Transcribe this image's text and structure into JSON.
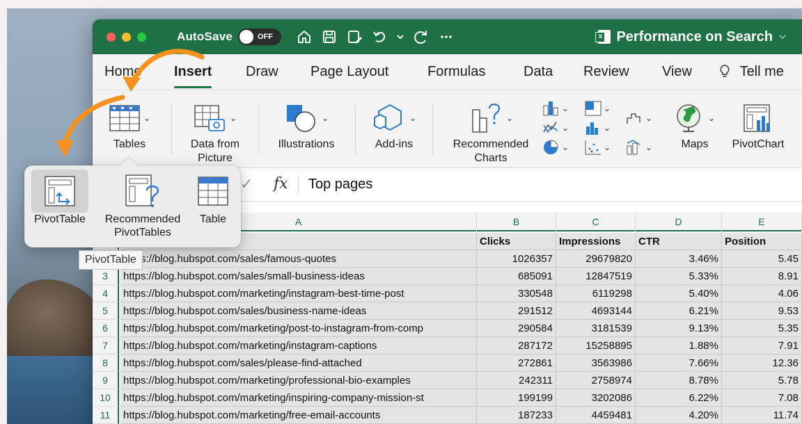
{
  "window": {
    "autosave_label": "AutoSave",
    "autosave_state": "OFF",
    "doc_title": "Performance on Search"
  },
  "tabs": [
    {
      "label": "Home"
    },
    {
      "label": "Insert",
      "active": true
    },
    {
      "label": "Draw"
    },
    {
      "label": "Page Layout"
    },
    {
      "label": "Formulas"
    },
    {
      "label": "Data"
    },
    {
      "label": "Review"
    },
    {
      "label": "View"
    },
    {
      "label": "Tell me"
    }
  ],
  "ribbon": {
    "tables": "Tables",
    "data_from_picture_1": "Data from",
    "data_from_picture_2": "Picture",
    "illustrations": "Illustrations",
    "addins": "Add-ins",
    "recommended_charts_1": "Recommended",
    "recommended_charts_2": "Charts",
    "maps": "Maps",
    "pivotchart": "PivotChart"
  },
  "popover": {
    "pivottable": "PivotTable",
    "recommended_1": "Recommended",
    "recommended_2": "PivotTables",
    "table": "Table",
    "tooltip": "PivotTable"
  },
  "formula": {
    "fx": "fx",
    "value": "Top pages"
  },
  "columns": [
    "A",
    "B",
    "C",
    "D",
    "E"
  ],
  "headers": {
    "clicks": "Clicks",
    "impressions": "Impressions",
    "ctr": "CTR",
    "position": "Position"
  },
  "rows": [
    {
      "num": "2",
      "url": "https://blog.hubspot.com/sales/famous-quotes",
      "clicks": "1026357",
      "impressions": "29679820",
      "ctr": "3.46%",
      "position": "5.45"
    },
    {
      "num": "3",
      "url": "https://blog.hubspot.com/sales/small-business-ideas",
      "clicks": "685091",
      "impressions": "12847519",
      "ctr": "5.33%",
      "position": "8.91"
    },
    {
      "num": "4",
      "url": "https://blog.hubspot.com/marketing/instagram-best-time-post",
      "clicks": "330548",
      "impressions": "6119298",
      "ctr": "5.40%",
      "position": "4.06"
    },
    {
      "num": "5",
      "url": "https://blog.hubspot.com/sales/business-name-ideas",
      "clicks": "291512",
      "impressions": "4693144",
      "ctr": "6.21%",
      "position": "9.53"
    },
    {
      "num": "6",
      "url": "https://blog.hubspot.com/marketing/post-to-instagram-from-comp",
      "clicks": "290584",
      "impressions": "3181539",
      "ctr": "9.13%",
      "position": "5.35"
    },
    {
      "num": "7",
      "url": "https://blog.hubspot.com/marketing/instagram-captions",
      "clicks": "287172",
      "impressions": "15258895",
      "ctr": "1.88%",
      "position": "7.91"
    },
    {
      "num": "8",
      "url": "https://blog.hubspot.com/sales/please-find-attached",
      "clicks": "272861",
      "impressions": "3563986",
      "ctr": "7.66%",
      "position": "12.36"
    },
    {
      "num": "9",
      "url": "https://blog.hubspot.com/marketing/professional-bio-examples",
      "clicks": "242311",
      "impressions": "2758974",
      "ctr": "8.78%",
      "position": "5.78"
    },
    {
      "num": "10",
      "url": "https://blog.hubspot.com/marketing/inspiring-company-mission-st",
      "clicks": "199199",
      "impressions": "3202086",
      "ctr": "6.22%",
      "position": "7.08"
    },
    {
      "num": "11",
      "url": "https://blog.hubspot.com/marketing/free-email-accounts",
      "clicks": "187233",
      "impressions": "4459481",
      "ctr": "4.20%",
      "position": "11.74"
    }
  ],
  "colors": {
    "excel_green": "#1e7045",
    "annotation_orange": "#f5911e"
  }
}
